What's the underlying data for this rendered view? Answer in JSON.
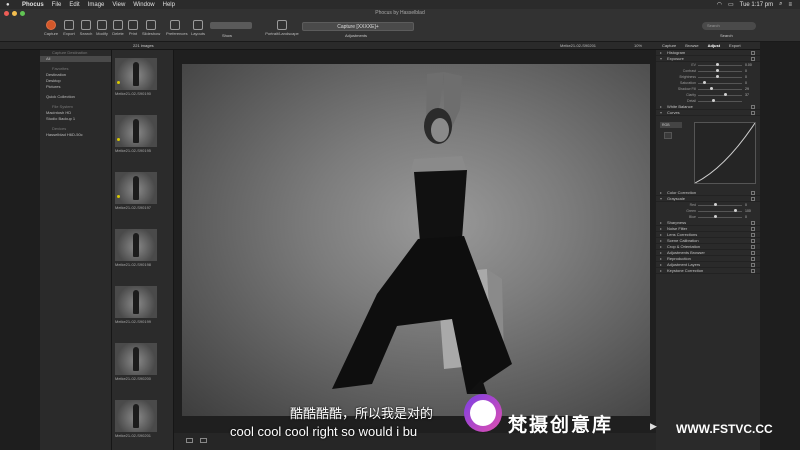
{
  "menubar": {
    "app": "Phocus",
    "items": [
      "File",
      "Edit",
      "Image",
      "View",
      "Window",
      "Help"
    ],
    "time": "Tue 1:17 pm"
  },
  "window": {
    "title": "Phocus by Hasselblad"
  },
  "toolbar": {
    "buttons": [
      "Capture",
      "Export",
      "Search",
      "Modify",
      "Delete",
      "Print",
      "Slideshow",
      "Preferences",
      "Layouts"
    ],
    "show_label": "Show",
    "portrait_label": "Portrait/Landscape",
    "capture_select": "Capture [XXXXE]+",
    "adjustments_label": "Adjustments",
    "search_placeholder": "Search",
    "search_label": "Search"
  },
  "subbar": {
    "image_count": "221 images",
    "filename": "Meike21-02-S90201",
    "zoom": "10%",
    "right_tabs": [
      "Capture",
      "Browse",
      "Adjust",
      "Export"
    ]
  },
  "browser": {
    "header": "Capture Destination",
    "root": "All",
    "sections": [
      {
        "title": "Favorites",
        "items": [
          "Destination",
          "Desktop",
          "Pictures"
        ]
      },
      {
        "title": "",
        "items": [
          "Quick Collection"
        ]
      },
      {
        "title": "File System",
        "items": [
          "Macintosh HD",
          "Studio Backup 1"
        ]
      },
      {
        "title": "Devices",
        "items": [
          "Hasselblad H6D-50c"
        ]
      }
    ]
  },
  "thumbnails": [
    {
      "label": "Meike21-02-S90190",
      "rated": true
    },
    {
      "label": "Meike21-02-S90195",
      "rated": true
    },
    {
      "label": "Meike21-02-S90197",
      "rated": true
    },
    {
      "label": "Meike21-02-S90198",
      "rated": false
    },
    {
      "label": "Meike21-02-S90199",
      "rated": false
    },
    {
      "label": "Meike21-02-S90200",
      "rated": false
    },
    {
      "label": "Meike21-02-S90201",
      "rated": false
    }
  ],
  "adjust": {
    "histogram": "Histogram",
    "exposure": {
      "title": "Exposure",
      "sliders": [
        {
          "name": "EV",
          "value": "0.00",
          "pos": 0.45
        },
        {
          "name": "Contrast",
          "value": "0",
          "pos": 0.45
        },
        {
          "name": "Brightness",
          "value": "0",
          "pos": 0.45
        },
        {
          "name": "Saturation",
          "value": "0",
          "pos": 0.15
        },
        {
          "name": "Shadow Fill",
          "value": "29",
          "pos": 0.3
        },
        {
          "name": "Clarity",
          "value": "37",
          "pos": 0.62
        },
        {
          "name": "Detail",
          "value": "",
          "pos": 0.35
        }
      ]
    },
    "white_balance": "White Balance",
    "curves": {
      "title": "Curves",
      "channel": "RGB"
    },
    "color_correction": "Color Correction",
    "grayscale": {
      "title": "Grayscale",
      "sliders": [
        {
          "name": "Red",
          "value": "0",
          "pos": 0.4
        },
        {
          "name": "Green",
          "value": "100",
          "pos": 0.85
        },
        {
          "name": "Blue",
          "value": "0",
          "pos": 0.4
        }
      ]
    },
    "other_tools": [
      "Sharpness",
      "Noise Filter",
      "Lens Corrections",
      "Scene Calibration",
      "Crop & Orientation",
      "Adjustments Browser",
      "Reproduction",
      "Adjustment Layers",
      "Keystone Correction"
    ]
  },
  "overlay": {
    "subtitle_cn": "酷酷酷酷，所以我是对的",
    "subtitle_en": "cool cool cool right so would i bu",
    "watermark_text": "梵摄创意库",
    "watermark_url": "WWW.FSTVC.CC"
  }
}
